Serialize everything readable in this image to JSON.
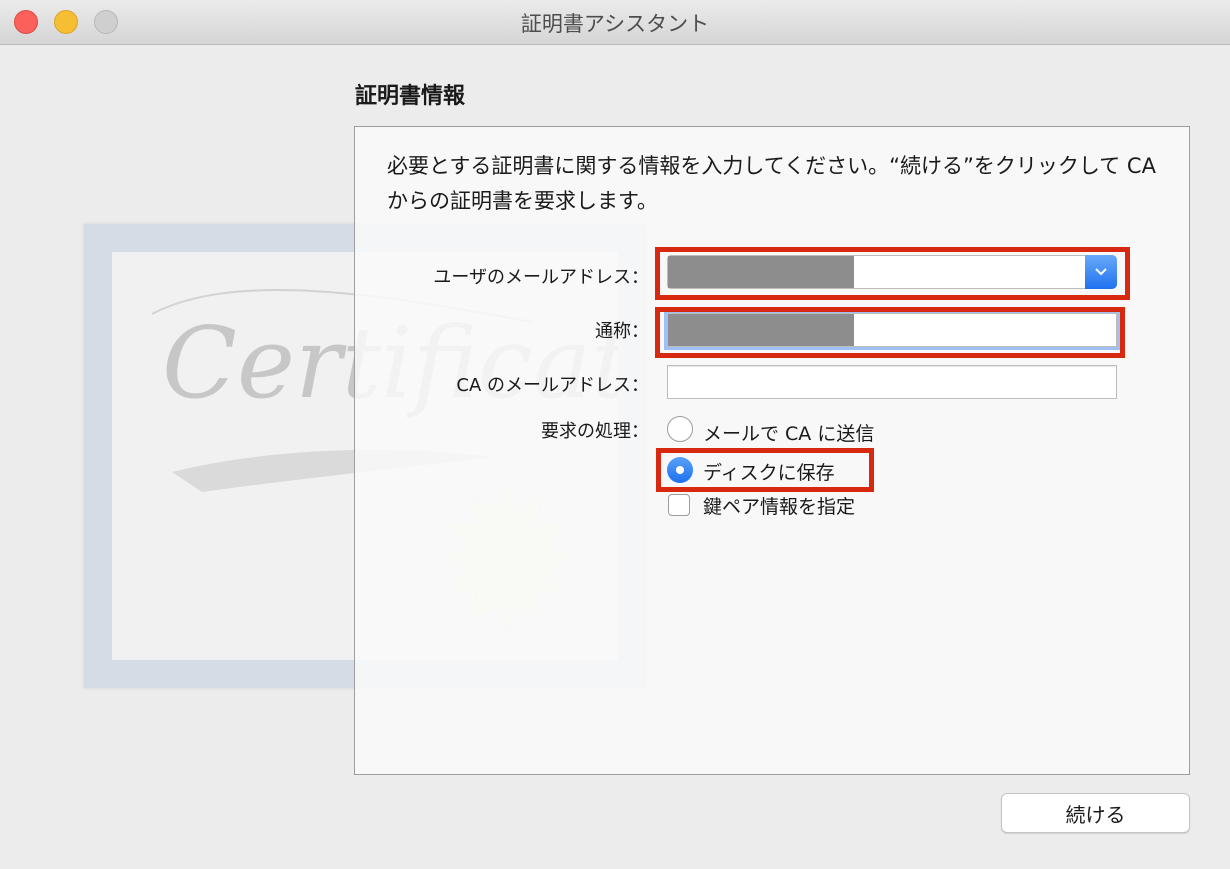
{
  "window": {
    "title": "証明書アシスタント"
  },
  "icons": {
    "close": "close-icon",
    "minimize": "minimize-icon",
    "zoom": "zoom-icon",
    "dropdown": "chevron-down-icon",
    "artwork": "certificate-icon"
  },
  "colors": {
    "accent": "#1f72f0",
    "highlight": "#d6290f",
    "redaction": "#8d8d8d"
  },
  "section": {
    "title": "証明書情報"
  },
  "intro": {
    "text": "必要とする証明書に関する情報を入力してください。“続ける”をクリックして CA からの証明書を要求します。"
  },
  "form": {
    "user_email_label": "ユーザのメールアドレス：",
    "common_name_label": "通称：",
    "ca_email_label": "CA のメールアドレス：",
    "request_label": "要求の処理：",
    "options": {
      "email_to_ca": "メールで CA に送信",
      "save_to_disk": "ディスクに保存",
      "specify_key_pair": "鍵ペア情報を指定"
    },
    "selected_option": "save_to_disk",
    "specify_key_pair_checked": false,
    "ca_email_value": ""
  },
  "buttons": {
    "continue": "続ける"
  },
  "artwork": {
    "text": "Certificate"
  }
}
